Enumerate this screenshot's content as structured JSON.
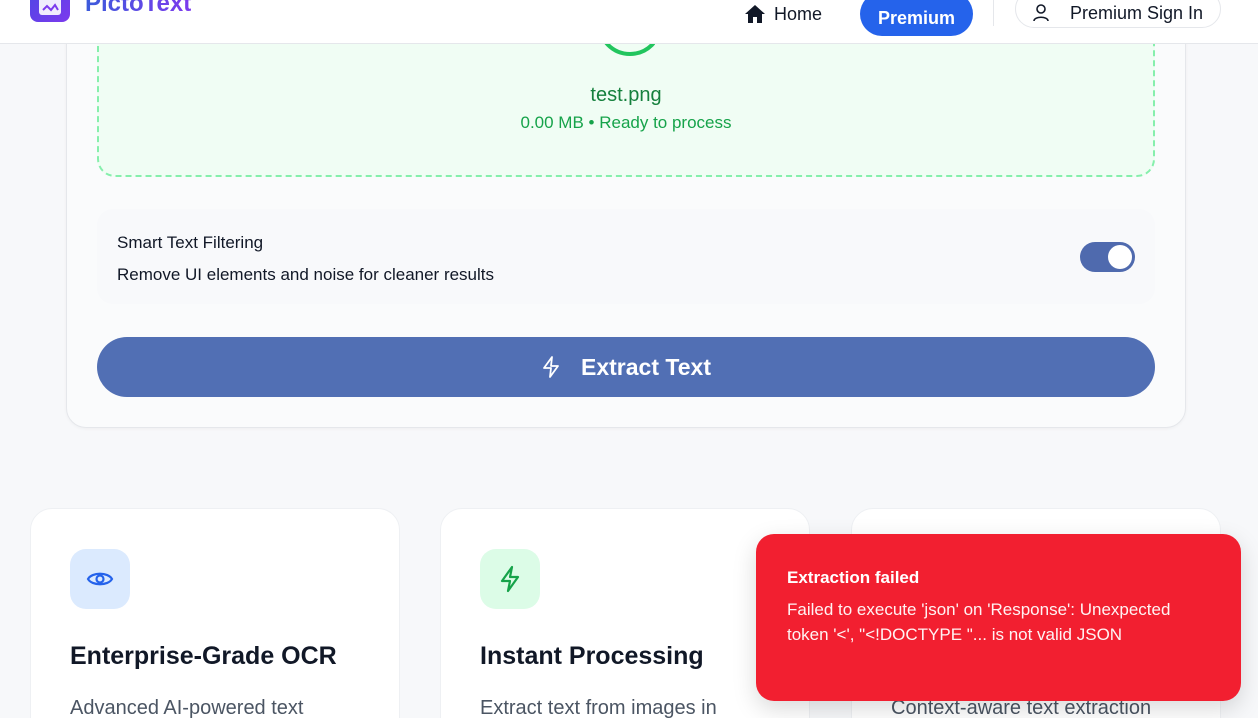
{
  "header": {
    "logo_text": "PictoText",
    "nav": {
      "home_label": "Home",
      "premium_label": "Premium",
      "signin_label": "Premium Sign In"
    }
  },
  "upload": {
    "file_name": "test.png",
    "file_meta": "0.00 MB • Ready to process",
    "filter": {
      "title": "Smart Text Filtering",
      "description": "Remove UI elements and noise for cleaner results",
      "enabled": true
    },
    "extract_label": "Extract Text"
  },
  "features": [
    {
      "icon": "eye-icon",
      "title": "Enterprise-Grade OCR",
      "description": "Advanced AI-powered text",
      "icon_bg": "#dbeafe",
      "icon_color": "#2563eb"
    },
    {
      "icon": "lightning-icon",
      "title": "Instant Processing",
      "description": "Extract text from images in",
      "icon_bg": "#dcfce7",
      "icon_color": "#16a34a"
    },
    {
      "icon": "",
      "title": "",
      "description": "Context-aware text extraction"
    }
  ],
  "toast": {
    "title": "Extraction failed",
    "message": "Failed to execute 'json' on 'Response': Unexpected token '<', \"<!DOCTYPE \"... is not valid JSON",
    "color": "#f21f30"
  },
  "colors": {
    "accent": "#2563eb",
    "extract_button": "#516fb4",
    "success": "#22c55e"
  }
}
